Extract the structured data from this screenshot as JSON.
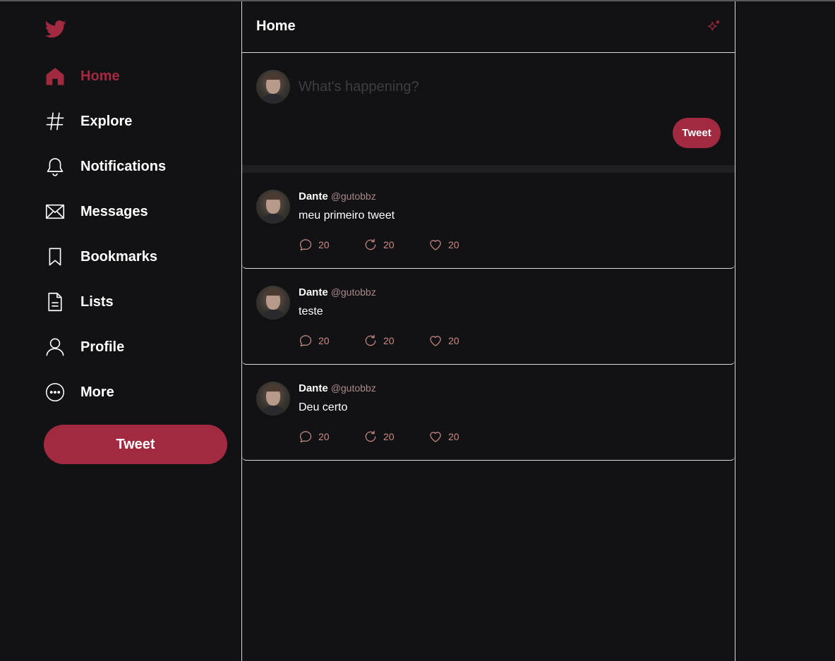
{
  "sidebar": {
    "items": [
      {
        "label": "Home",
        "icon": "home-icon"
      },
      {
        "label": "Explore",
        "icon": "hashtag-icon"
      },
      {
        "label": "Notifications",
        "icon": "bell-icon"
      },
      {
        "label": "Messages",
        "icon": "envelope-icon"
      },
      {
        "label": "Bookmarks",
        "icon": "bookmark-icon"
      },
      {
        "label": "Lists",
        "icon": "document-icon"
      },
      {
        "label": "Profile",
        "icon": "user-icon"
      },
      {
        "label": "More",
        "icon": "more-icon"
      }
    ],
    "tweet_button": "Tweet"
  },
  "header": {
    "title": "Home"
  },
  "composer": {
    "placeholder": "What's happening?",
    "button": "Tweet"
  },
  "tweets": [
    {
      "name": "Dante",
      "handle": "@gutobbz",
      "text": "meu primeiro tweet",
      "replies": "20",
      "retweets": "20",
      "likes": "20"
    },
    {
      "name": "Dante",
      "handle": "@gutobbz",
      "text": "teste",
      "replies": "20",
      "retweets": "20",
      "likes": "20"
    },
    {
      "name": "Dante",
      "handle": "@gutobbz",
      "text": "Deu certo",
      "replies": "20",
      "retweets": "20",
      "likes": "20"
    }
  ],
  "colors": {
    "accent": "#a12a41",
    "background": "#121214",
    "count": "#c98a86"
  }
}
